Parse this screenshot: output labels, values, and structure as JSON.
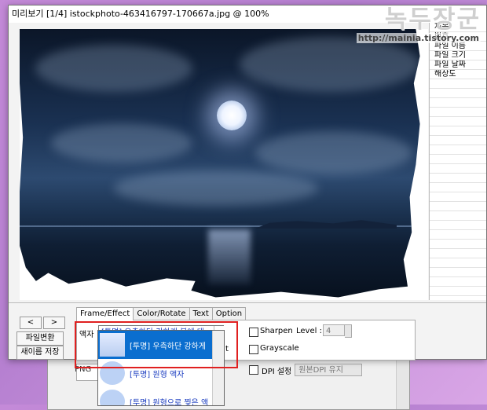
{
  "window": {
    "title": "미리보기 [1/4] istockphoto-463416797-170667a.jpg @ 100%"
  },
  "info_panel": {
    "rows": [
      "제목",
      "번호",
      "파일 이름",
      "파일 크기",
      "파일 날짜",
      "해상도"
    ]
  },
  "nav": {
    "prev": "<",
    "next": ">",
    "convert": "파일변환",
    "save_as": "새이름 저장"
  },
  "tabs": [
    "Frame/Effect",
    "Color/Rotate",
    "Text",
    "Option"
  ],
  "frame": {
    "label": "액자",
    "selected": "[투명] 우측하단 강하게 불에 태",
    "options": [
      "[투명] 우측하단 강하게",
      "[투명] 원형 액자",
      "[투명] 원형으로 찢은 액"
    ]
  },
  "effects": {
    "sharpen": "Sharpen",
    "level_label": "Level :",
    "level_value": "4",
    "grayscale": "Grayscale",
    "partial_t": "t"
  },
  "background_window": {
    "format": "PNG",
    "dpi_label": "DPI 설정",
    "dpi_value": "원본DPI 유지"
  },
  "watermark": {
    "title": "녹두장군",
    "url": "http://mainia.tistory.com"
  }
}
